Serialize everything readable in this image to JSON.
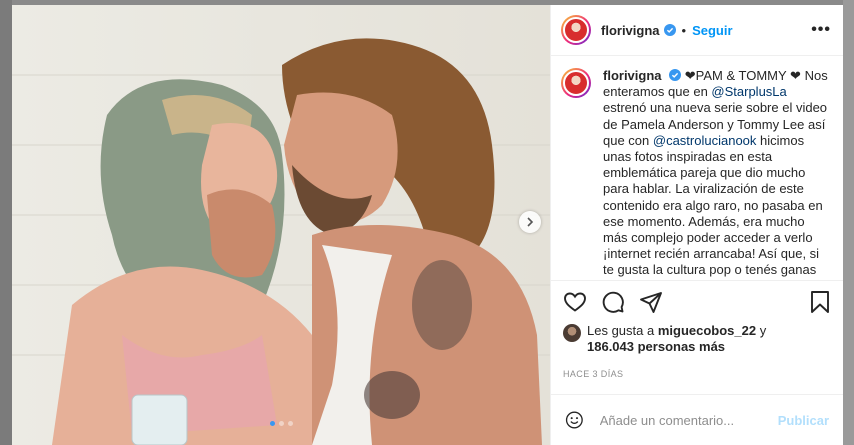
{
  "post": {
    "username": "florivigna",
    "follow_label": "Seguir",
    "separator": "•",
    "more_label": "•••",
    "caption_title": "❤PAM & TOMMY ❤",
    "caption_parts": [
      "Nos enteramos que en ",
      "@StarplusLa",
      " estrenó una nueva serie sobre el video de Pamela Anderson y Tommy Lee así que con ",
      "@castrolucianook",
      " hicimos unas fotos inspiradas en esta emblemática pareja que dio mucho para hablar. La viralización de este contenido era algo raro, no pasaba en ese momento. Además, era mucho más complejo poder acceder a verlo ¡internet recién arrancaba! Así que, si te gusta la cultura pop o tenés ganas"
    ],
    "likes_prefix": "Les gusta a ",
    "likes_user": "miguecobos_22",
    "likes_mid": " y",
    "likes_count": "186.043 personas más",
    "timestamp": "HACE 3 DÍAS",
    "comment_placeholder": "Añade un comentario...",
    "post_button": "Publicar",
    "carousel": {
      "current": 1,
      "total": 3
    }
  },
  "icons": [
    "verified-icon",
    "heart-icon",
    "comment-icon",
    "share-icon",
    "bookmark-icon",
    "emoji-icon",
    "chevron-right-icon",
    "more-icon"
  ],
  "colors": {
    "link": "#0095f6",
    "mention": "#00376b",
    "muted": "#8e8e8e",
    "post_disabled": "#b2dffc"
  }
}
